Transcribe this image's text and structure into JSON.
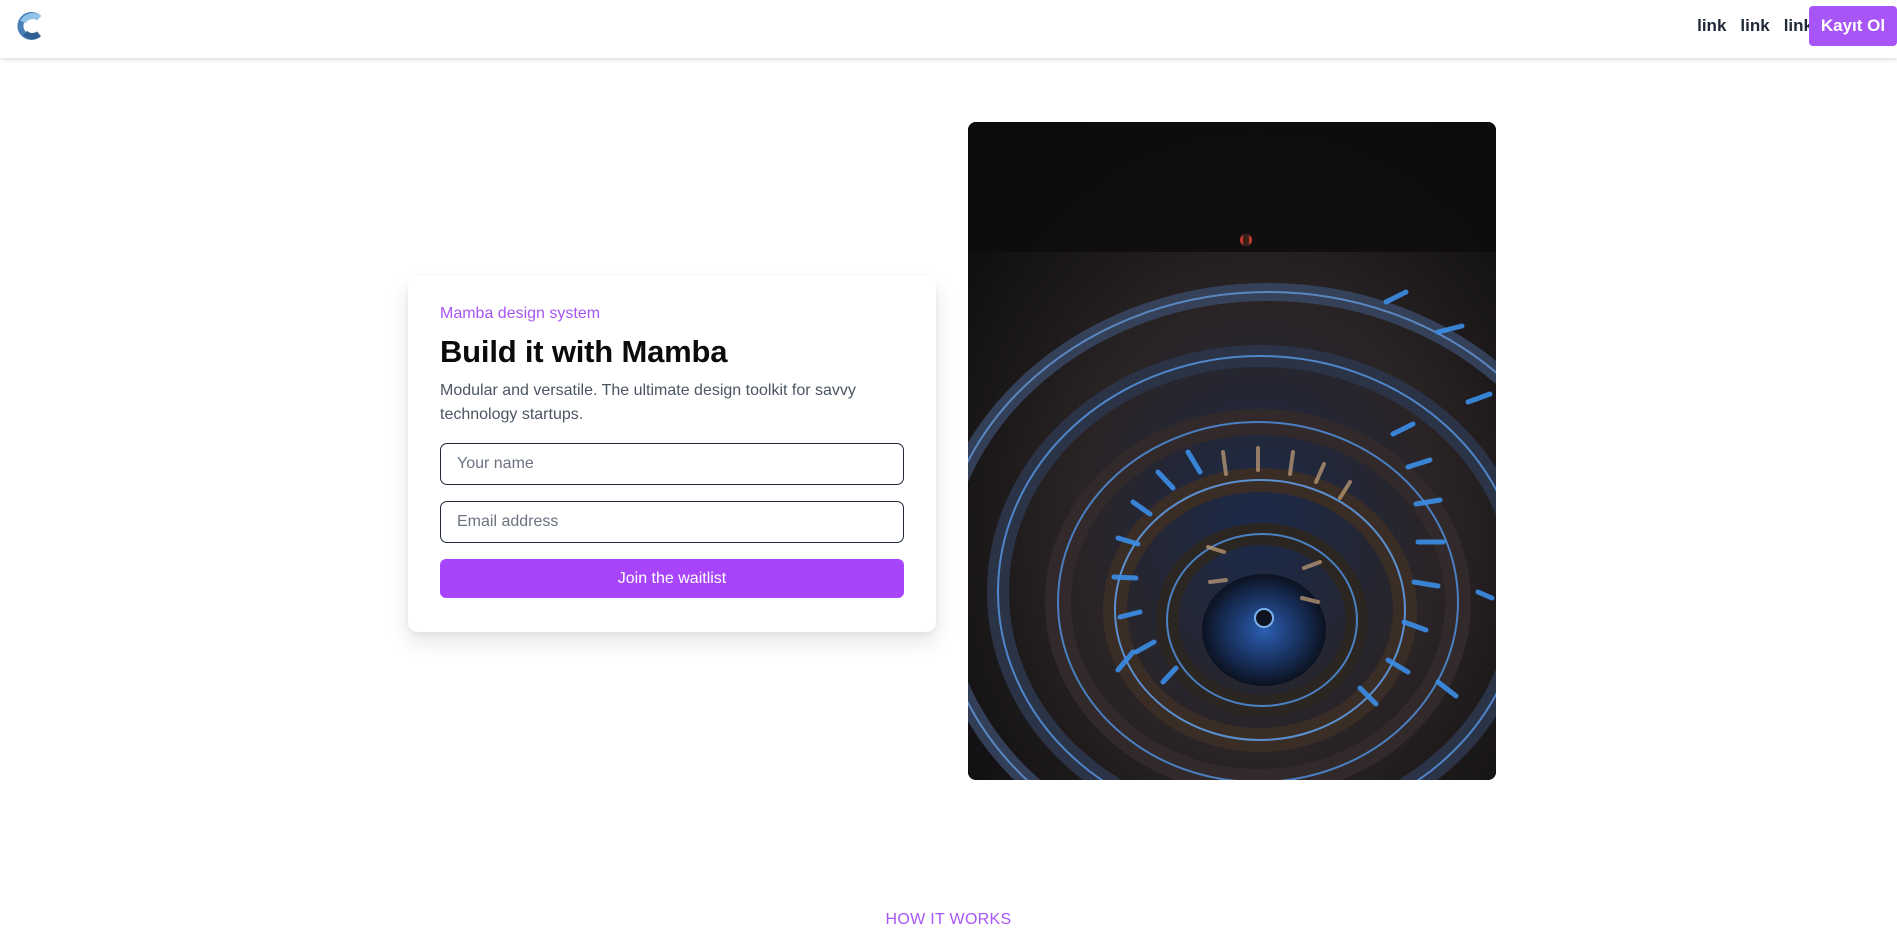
{
  "header": {
    "logo_icon": "c-logo-icon",
    "nav_links": [
      "link",
      "link",
      "link"
    ],
    "signup_label": "Kayıt Ol"
  },
  "hero": {
    "eyebrow": "Mamba design system",
    "title": "Build it with Mamba",
    "subtitle": "Modular and versatile. The ultimate design toolkit for savvy technology startups.",
    "name_placeholder": "Your name",
    "email_placeholder": "Email address",
    "submit_label": "Join the waitlist",
    "image_icon": "spiral-staircase-photo"
  },
  "section": {
    "label": "HOW IT WORKS"
  },
  "colors": {
    "accent": "#a855f7",
    "text_dark": "#0b0b0b",
    "text_muted": "#4b5563",
    "nav_text": "#1f2937",
    "photo_blue": "#3b8ee8"
  }
}
